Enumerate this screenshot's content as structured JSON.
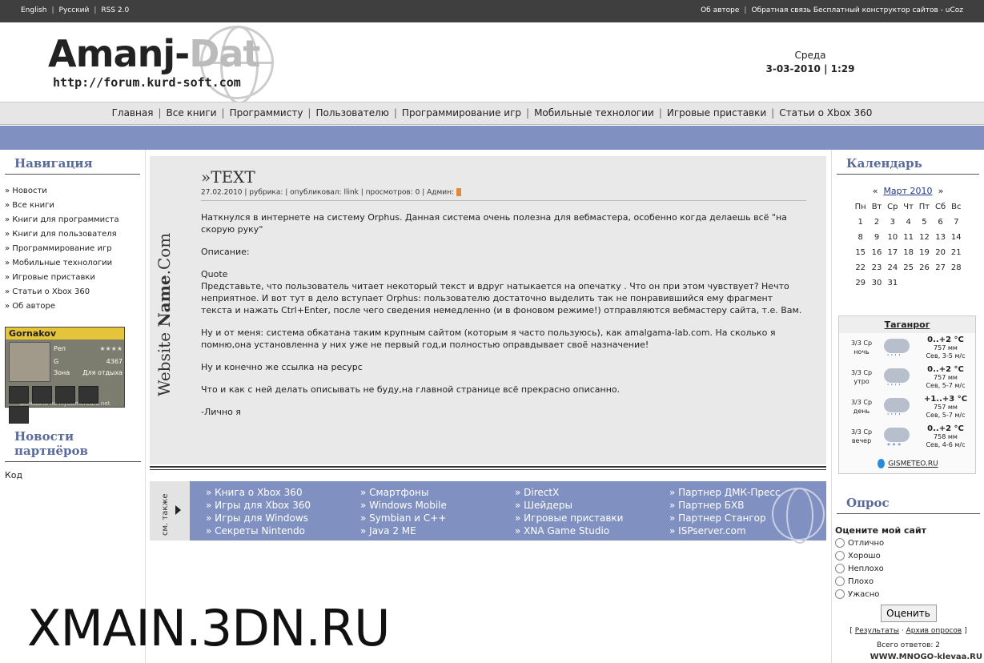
{
  "topbar": {
    "lang_en": "English",
    "lang_ru": "Русский",
    "rss": "RSS 2.0",
    "about": "Об авторе",
    "feedback": "Обратная связь",
    "builder": "Бесплатный конструктор сайтов - uCoz"
  },
  "header": {
    "logo_main": "Amanj-",
    "logo_fade": "Dat",
    "logo_url": "http://forum.kurd-soft.com",
    "day": "Среда",
    "date": "3-03-2010",
    "time": "1:29"
  },
  "menu": [
    "Главная",
    "Все книги",
    "Программисту",
    "Пользователю",
    "Программирование игр",
    "Мобильные технологии",
    "Игровые приставки",
    "Статьи о Xbox 360"
  ],
  "sidebar_left": {
    "nav_title": "Навигация",
    "nav_items": [
      "Новости",
      "Все книги",
      "Книги для программиста",
      "Книги для пользователя",
      "Программирование игр",
      "Мобильные технологии",
      "Игровые приставки",
      "Статьи о Xbox 360",
      "Об авторе"
    ],
    "gamercard": {
      "tag": "Gornakov",
      "rep_label": "Реп",
      "rep_stars": "★★★★",
      "gs_label": "G",
      "gs_value": "4367",
      "zone_label": "Зона",
      "zone_value": "Для отдыха",
      "footer": "Основано на MyGamerCard.net"
    },
    "partners_title": "Новости партнёров",
    "partners_body": "Код"
  },
  "post": {
    "vertical_logo_a": "Website ",
    "vertical_logo_b": "Name",
    "vertical_logo_c": ".Com",
    "title": "»TEXT",
    "meta": "27.02.2010 | рубрика: | опубликовал: llink | просмотров: 0 | Админ:",
    "paragraphs": [
      "Наткнулся в интернете на систему Orphus. Данная система очень полезна для вебмастера, особенно когда делаешь всё \"на скорую руку\"",
      "Описание:",
      "Quote\nПредставьте, что пользователь читает некоторый текст и вдруг натыкается на опечатку . Что он при этом чувствует? Нечто неприятное. И вот тут в дело вступает Orphus: пользователю достаточно выделить так не понравившийся ему фрагмент текста и нажать Ctrl+Enter, после чего сведения немедленно (и в фоновом режиме!) отправляются вебмастеру сайта, т.е. Вам.",
      "Ну и от меня: система обкатана таким крупным сайтом (которым я часто пользуюсь), как amalgama-lab.com. На сколько я помню,она установленна у них уже не первый год,и полностью оправдывает своё назначение!",
      "Ну и конечно же ссылка на ресурс",
      "Что и как с ней делать описывать не буду,на главной странице всё прекрасно описанно.",
      "-Лично я"
    ]
  },
  "see_also": {
    "label": "см. также",
    "columns": [
      [
        "Книга о Xbox 360",
        "Игры для Xbox 360",
        "Игры для Windows",
        "Секреты Nintendo"
      ],
      [
        "Смартфоны",
        "Windows Mobile",
        "Symbian и C++",
        "Java 2 ME"
      ],
      [
        "DirectX",
        "Шейдеры",
        "Игровые приставки",
        "XNA Game Studio"
      ],
      [
        "Партнер ДМК-Пресс",
        "Партнер БХВ",
        "Партнер Стангор",
        "ISPserver.com"
      ]
    ]
  },
  "calendar": {
    "title": "Календарь",
    "prev": "«",
    "month": "Март 2010",
    "next": "»",
    "weekdays": [
      "Пн",
      "Вт",
      "Ср",
      "Чт",
      "Пт",
      "Сб",
      "Вс"
    ],
    "weeks": [
      [
        "1",
        "2",
        "3",
        "4",
        "5",
        "6",
        "7"
      ],
      [
        "8",
        "9",
        "10",
        "11",
        "12",
        "13",
        "14"
      ],
      [
        "15",
        "16",
        "17",
        "18",
        "19",
        "20",
        "21"
      ],
      [
        "22",
        "23",
        "24",
        "25",
        "26",
        "27",
        "28"
      ],
      [
        "29",
        "30",
        "31",
        "",
        "",
        "",
        ""
      ]
    ]
  },
  "weather": {
    "city": "Таганрог",
    "rows": [
      {
        "when": "3/3 Ср ночь",
        "temp": "0..+2 °C",
        "pressure": "757 мм",
        "wind": "Сев, 3-5 м/с"
      },
      {
        "when": "3/3 Ср утро",
        "temp": "0..+2 °C",
        "pressure": "757 мм",
        "wind": "Сев, 5-7 м/с"
      },
      {
        "when": "3/3 Ср день",
        "temp": "+1..+3 °C",
        "pressure": "757 мм",
        "wind": "Сев, 5-7 м/с"
      },
      {
        "when": "3/3 Ср вечер",
        "temp": "0..+2 °C",
        "pressure": "758 мм",
        "wind": "Сев, 4-6 м/с"
      }
    ],
    "provider": "GISMETEO.RU"
  },
  "poll": {
    "title": "Опрос",
    "question": "Оцените мой сайт",
    "options": [
      "Отлично",
      "Хорошо",
      "Неплохо",
      "Плохо",
      "Ужасно"
    ],
    "button": "Оценить",
    "results": "Результаты",
    "archive": "Архив опросов",
    "total": "Всего ответов: 2"
  },
  "watermarks": {
    "big": "XMAIN.3DN.RU",
    "small": "WWW.MNOGO-klevaa.RU"
  }
}
